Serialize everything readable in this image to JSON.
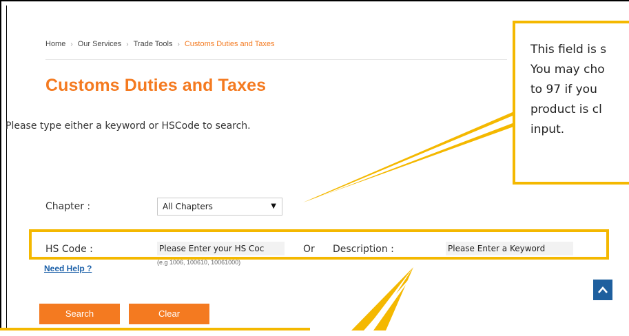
{
  "breadcrumb": {
    "home": "Home",
    "our_services": "Our Services",
    "trade_tools": "Trade Tools",
    "current": "Customs Duties and Taxes",
    "separator": "›"
  },
  "page": {
    "title": "Customs Duties and Taxes",
    "instruction": "Please type either a keyword or HSCode to search."
  },
  "form": {
    "chapter_label": "Chapter :",
    "chapter_value": "All Chapters",
    "hs_code_label": "HS Code :",
    "hs_code_placeholder": "Please Enter your HS Coc",
    "or_label": "Or",
    "description_label": "Description :",
    "description_placeholder": "Please Enter a Keyword",
    "hs_code_hint": "(e.g 1006, 100610, 10061000)",
    "need_help": "Need Help ?",
    "search_button": "Search",
    "clear_button": "Clear"
  },
  "annotation": {
    "callout_lines": [
      "This field is s",
      "You may cho",
      "to 97 if you",
      "product is cl",
      "input."
    ],
    "highlight_color": "#f4b800"
  },
  "colors": {
    "accent": "#f47a20",
    "link": "#1a5fa8",
    "scroll_button": "#1e5f9e"
  },
  "icons": {
    "select_arrow": "▼",
    "scroll_top": "chevron-up-icon"
  }
}
